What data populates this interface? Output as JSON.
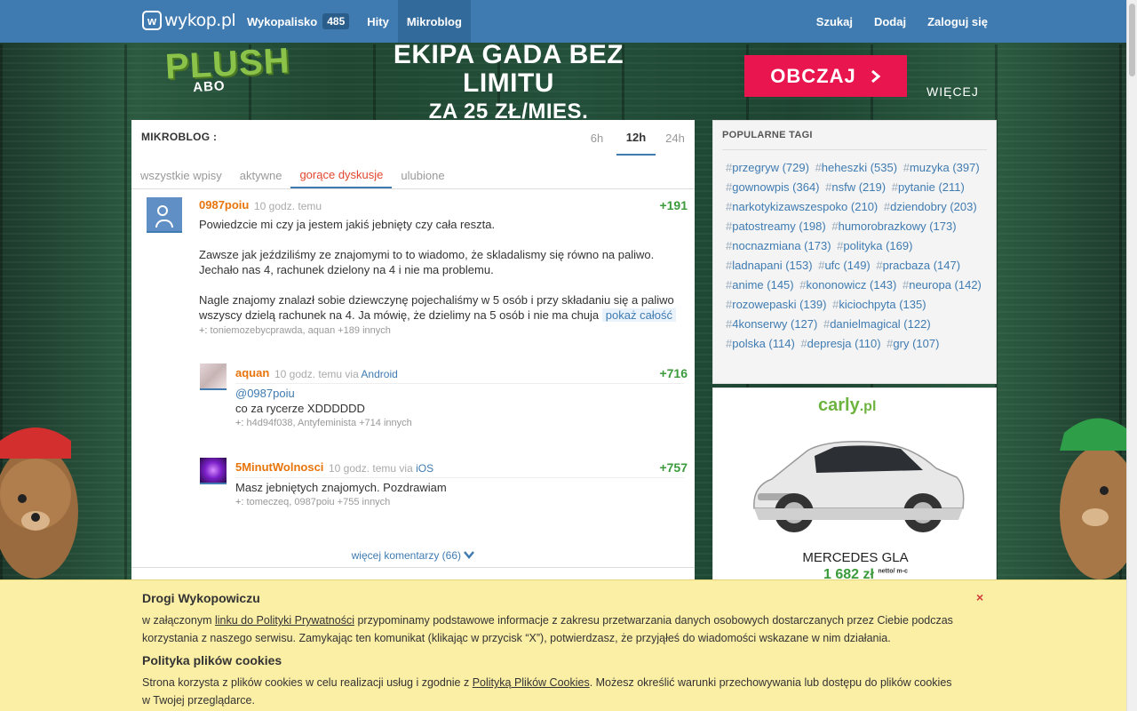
{
  "topbar": {
    "logo_icon": "w",
    "logo_text": "wykop.pl",
    "nav": [
      {
        "label": "Wykopalisko",
        "badge": "485"
      },
      {
        "label": "Hity"
      },
      {
        "label": "Mikroblog",
        "active": true
      }
    ],
    "right": [
      "Szukaj",
      "Dodaj",
      "Zaloguj się"
    ]
  },
  "banner": {
    "logo": "PLUSH",
    "logo_sub": "ABO",
    "headline": "EKIPA GADA BEZ LIMITU",
    "subline": "ZA 25 ZŁ/MIES.",
    "cta": "OBCZAJ",
    "cta_icon": "chevron-right-icon",
    "more": "WIĘCEJ"
  },
  "mikroblog": {
    "title": "MIKROBLOG :",
    "time_tabs": [
      "6h",
      "12h",
      "24h"
    ],
    "active_time": "12h",
    "feed_tabs": [
      "wszystkie wpisy",
      "aktywne",
      "gorące dyskusje",
      "ulubione"
    ],
    "active_feed": "gorące dyskusje",
    "entry": {
      "author": "0987poiu",
      "time": "10 godz. temu",
      "score": "+191",
      "text": "Powiedzcie mi czy ja jestem jakiś jebnięty czy cała reszta.\n\nZawsze jak jeździliśmy ze znajomymi to to wiadomo, że skladalismy się równo na paliwo. Jechało nas 4, rachunek dzielony na 4 i nie ma problemu.\n\nNagle znajomy znalazł sobie dziewczynę pojechaliśmy w 5 osób i przy składaniu się a paliwo wszyscy dzielą rachunek na 4. Ja mówię, że dzielimy na 5 osób i nie ma chuja",
      "show_more": "pokaż całość",
      "voters_prefix": "+:",
      "voters": "toniemozebycprawda, aquan +189 innych"
    },
    "comments": [
      {
        "author": "aquan",
        "time": "10 godz. temu",
        "via_label": "via",
        "via": "Android",
        "score": "+716",
        "mention": "@0987poiu",
        "text": "co za rycerze XDDDDDD",
        "voters_prefix": "+:",
        "voters": "h4d94f038, Antyfeminista +714 innych"
      },
      {
        "author": "5MinutWolnosci",
        "time": "10 godz. temu",
        "via_label": "via",
        "via": "iOS",
        "score": "+757",
        "text": "Masz jebniętych znajomych. Pozdrawiam",
        "voters_prefix": "+:",
        "voters": "tomeczeq, 0987poiu +755 innych"
      }
    ],
    "more_comments": "więcej komentarzy (66)"
  },
  "tags_box": {
    "title": "POPULARNE TAGI",
    "tags": [
      "przegryw (729)",
      "heheszki (535)",
      "muzyka (397)",
      "gownowpis (364)",
      "nsfw (219)",
      "pytanie (211)",
      "narkotykizawszespoko (210)",
      "dziendobry (203)",
      "patostreamy (198)",
      "humorobrazkowy (173)",
      "nocnazmiana (173)",
      "polityka (169)",
      "ladnapani (153)",
      "ufc (149)",
      "pracbaza (147)",
      "anime (145)",
      "kononowicz (143)",
      "neuropa (142)",
      "rozowepaski (139)",
      "kiciochpyta (135)",
      "4konserwy (127)",
      "danielmagical (122)",
      "polska (114)",
      "depresja (110)",
      "gry (107)"
    ]
  },
  "ad": {
    "brand": "carly",
    "brand_suffix": ".pl",
    "car_name": "MERCEDES GLA",
    "price": "1 682 zł",
    "price_note": "netto/ m-c"
  },
  "cookie": {
    "title": "Drogi Wykopowiczu",
    "p1_before": "w załączonym ",
    "p1_link": "linku do Polityki Prywatności",
    "p1_after": " przypominamy podstawowe informacje z zakresu przetwarzania danych osobowych dostarczanych przez Ciebie podczas korzystania z naszego serwisu. Zamykając ten komunikat (klikając w przycisk “X”), potwierdzasz, że przyjąłeś do wiadomości wskazane w nim działania.",
    "title2": "Polityka plików cookies",
    "p2_before": "Strona korzysta z plików cookies w celu realizacji usług i zgodnie z ",
    "p2_link": "Polityką Plików Cookies",
    "p2_after": ". Możesz określić warunki przechowywania lub dostępu do plików cookies w Twojej przeglądarce.",
    "close": "×"
  },
  "colors": {
    "brand_blue": "#3f7bb1",
    "author_orange": "#e8740c",
    "score_green": "#3b9b3b",
    "active_red": "#e3472f",
    "cta_pink": "#e8154f",
    "cookie_bg": "#fbeea5"
  }
}
